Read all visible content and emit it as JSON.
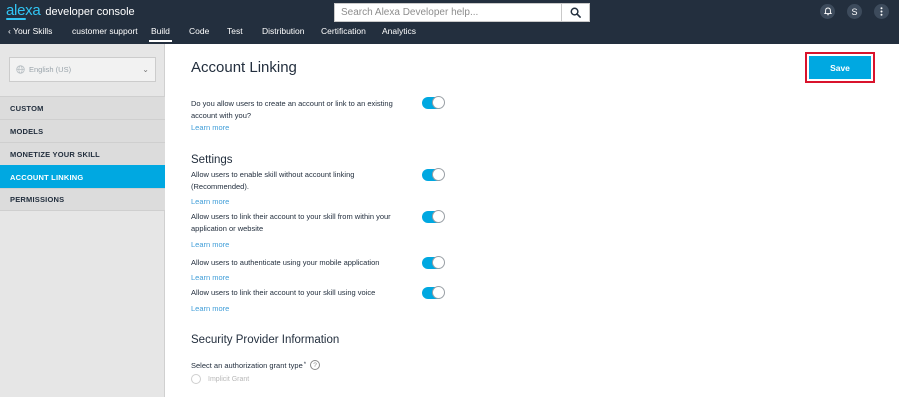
{
  "header": {
    "brand_logo": "alexa",
    "brand_title": "developer console",
    "search_placeholder": "Search Alexa Developer help...",
    "avatar_initial": "S"
  },
  "nav": {
    "back_label": "Your Skills",
    "skill_name": "customer support",
    "tabs": [
      "Build",
      "Code",
      "Test",
      "Distribution",
      "Certification",
      "Analytics"
    ],
    "active_tab": "Build"
  },
  "sidebar": {
    "locale": "English (US)",
    "items": [
      {
        "label": "CUSTOM"
      },
      {
        "label": "MODELS"
      },
      {
        "label": "MONETIZE YOUR SKILL"
      },
      {
        "label": "ACCOUNT LINKING"
      },
      {
        "label": "PERMISSIONS"
      }
    ],
    "active_item": "ACCOUNT LINKING"
  },
  "main": {
    "title": "Account Linking",
    "save_label": "Save",
    "question": {
      "text": "Do you allow users to create an account or link to an existing account with you?",
      "learn_more": "Learn more",
      "enabled": true
    },
    "settings_heading": "Settings",
    "settings": [
      {
        "text": "Allow users to enable skill without account linking (Recommended).",
        "learn_more": "Learn more",
        "enabled": true
      },
      {
        "text": "Allow users to link their account to your skill from within your application or website",
        "learn_more": "Learn more",
        "enabled": true
      },
      {
        "text": "Allow users to authenticate using your mobile application",
        "learn_more": "Learn more",
        "enabled": true
      },
      {
        "text": "Allow users to link their account to your skill using voice",
        "learn_more": "Learn more",
        "enabled": true
      }
    ],
    "security_heading": "Security Provider Information",
    "grant_label": "Select an authorization grant type",
    "grant_required_mark": "*",
    "help_glyph": "?",
    "grant_options": [
      "Implicit Grant"
    ]
  },
  "colors": {
    "topbar": "#232f3e",
    "accent": "#00a8e1",
    "link": "#3f9dd8",
    "highlight_border": "#d9132c"
  },
  "icons": {
    "back": "chevron-left-icon",
    "search": "search-icon",
    "notifications": "bell-icon",
    "more": "more-vertical-icon",
    "locale": "globe-icon",
    "dropdown": "chevron-down-icon",
    "help": "help-icon"
  }
}
